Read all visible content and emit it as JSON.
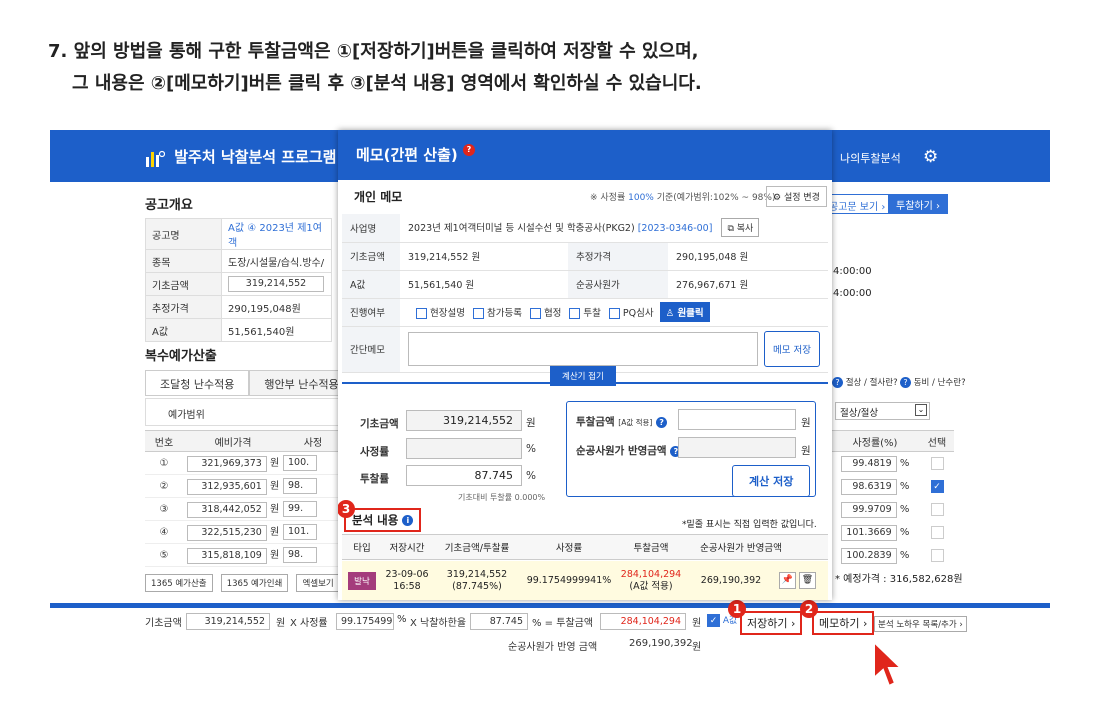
{
  "instruction": {
    "line1": "7. 앞의 방법을 통해 구한 투찰금액은 ①[저장하기]버튼을 클릭하여 저장할 수 있으며,",
    "line2": "그 내용은 ②[메모하기]버튼 클릭 후 ③[분석 내용] 영역에서 확인하실 수 있습니다."
  },
  "bg": {
    "app_title": "발주처 낙찰분석 프로그램",
    "top_link": "나의투찰분석",
    "btn_view": "공고문 보기",
    "btn_bid": "투찰하기",
    "section1": "공고개요",
    "info": [
      [
        "공고명",
        "A값 ④ 2023년 제1여객"
      ],
      [
        "종목",
        "도장/시설물/습식.방수/"
      ],
      [
        "기초금액",
        "319,214,552"
      ],
      [
        "추정가격",
        "290,195,048원"
      ],
      [
        "A값",
        "51,561,540원"
      ]
    ],
    "time1": "4:00:00",
    "time2": "4:00:00",
    "section2": "복수예가산출",
    "tab1": "조달청 난수적용",
    "tab2": "행안부 난수적용",
    "range_label": "예가범위",
    "help1": "절상 / 절사란?",
    "help2": "동비 / 난수란?",
    "round_select": "절상/절상",
    "col_no": "번호",
    "col_price": "예비가격",
    "col_rate_short": "사정",
    "col_rate": "사정률(%)",
    "col_sel": "선택",
    "rows": [
      {
        "no": "①",
        "price": "321,969,373",
        "rate": "100.",
        "r": "99.4819",
        "sel": false
      },
      {
        "no": "②",
        "price": "312,935,601",
        "rate": "98.",
        "r": "98.6319",
        "sel": true
      },
      {
        "no": "③",
        "price": "318,442,052",
        "rate": "99.",
        "r": "99.9709",
        "sel": false
      },
      {
        "no": "④",
        "price": "322,515,230",
        "rate": "101.",
        "r": "101.3669",
        "sel": false
      },
      {
        "no": "⑤",
        "price": "315,818,109",
        "rate": "98.",
        "r": "100.2839",
        "sel": false
      }
    ],
    "won": "원",
    "pct": "%",
    "btn_s1": "1365 예가산출",
    "btn_s2": "1365 예가인쇄",
    "btn_s3": "엑셀보기",
    "est_price": "* 예정가격 : 316,582,628원"
  },
  "bottom": {
    "l_base": "기초금액",
    "v_base": "319,214,552",
    "won": "원",
    "x1": "X 사정률",
    "v_rate": "99.175499",
    "pct": "%",
    "x2": "X 낙찰하한율",
    "v_low": "87.745",
    "eq": "% = 투찰금액",
    "v_bid": "284,104,294",
    "aval": "A값",
    "save": "저장하기",
    "memo": "메모하기",
    "extra": "분석 노하우 목록/추가",
    "l_adj": "순공사원가 반영 금액",
    "v_adj": "269,190,392"
  },
  "modal": {
    "title": "메모(간편 산출)",
    "subtitle": "개인 메모",
    "note_pre": "※ 사정률",
    "note_pct": "100%",
    "note_post": "기준(예가범위:102% ~ 98%)",
    "settings": "설정 변경",
    "l_name": "사업명",
    "v_name": "2023년 제1여객터미널 등 시설수선 및 학충공사(PKG2)",
    "v_code": "[2023-0346-00]",
    "copy": "복사",
    "l_base": "기초금액",
    "v_base": "319,214,552 원",
    "l_est": "추정가격",
    "v_est": "290,195,048 원",
    "l_a": "A값",
    "v_a": "51,561,540 원",
    "l_net": "순공사원가",
    "v_net": "276,967,671 원",
    "l_prog": "진행여부",
    "opts": [
      "현장설명",
      "참가등록",
      "협정",
      "투찰",
      "PQ심사"
    ],
    "oneclick": "원클릭",
    "l_memo": "간단메모",
    "memo_save": "메모 저장",
    "calc_tab": "계산기 접기",
    "c_base": "기초금액",
    "cv_base": "319,214,552",
    "c_rate": "사정률",
    "c_bid": "투찰률",
    "cv_bid": "87.745",
    "c_ratio": "기초대비 투찰률 0.000%",
    "c_bidamt": "투찰금액",
    "c_bidamt_sub": "[A값 적용]",
    "c_netamt": "순공사원가 반영금액",
    "c_save": "계산 저장",
    "won": "원",
    "pct": "%",
    "analysis": "분석 내용",
    "hint": "*밑줄 표시는 직접 입력한 값입니다.",
    "h": [
      "타입",
      "저장시간",
      "기초금액/투찰률",
      "사정률",
      "투찰금액",
      "순공사원가 반영금액"
    ],
    "r_type": "발낙",
    "r_date": "23-09-06",
    "r_time": "16:58",
    "r_base": "319,214,552",
    "r_rate2": "(87.745%)",
    "r_rate": "99.1754999941%",
    "r_amt": "284,104,294",
    "r_amt2": "(A값 적용)",
    "r_net": "269,190,392"
  }
}
